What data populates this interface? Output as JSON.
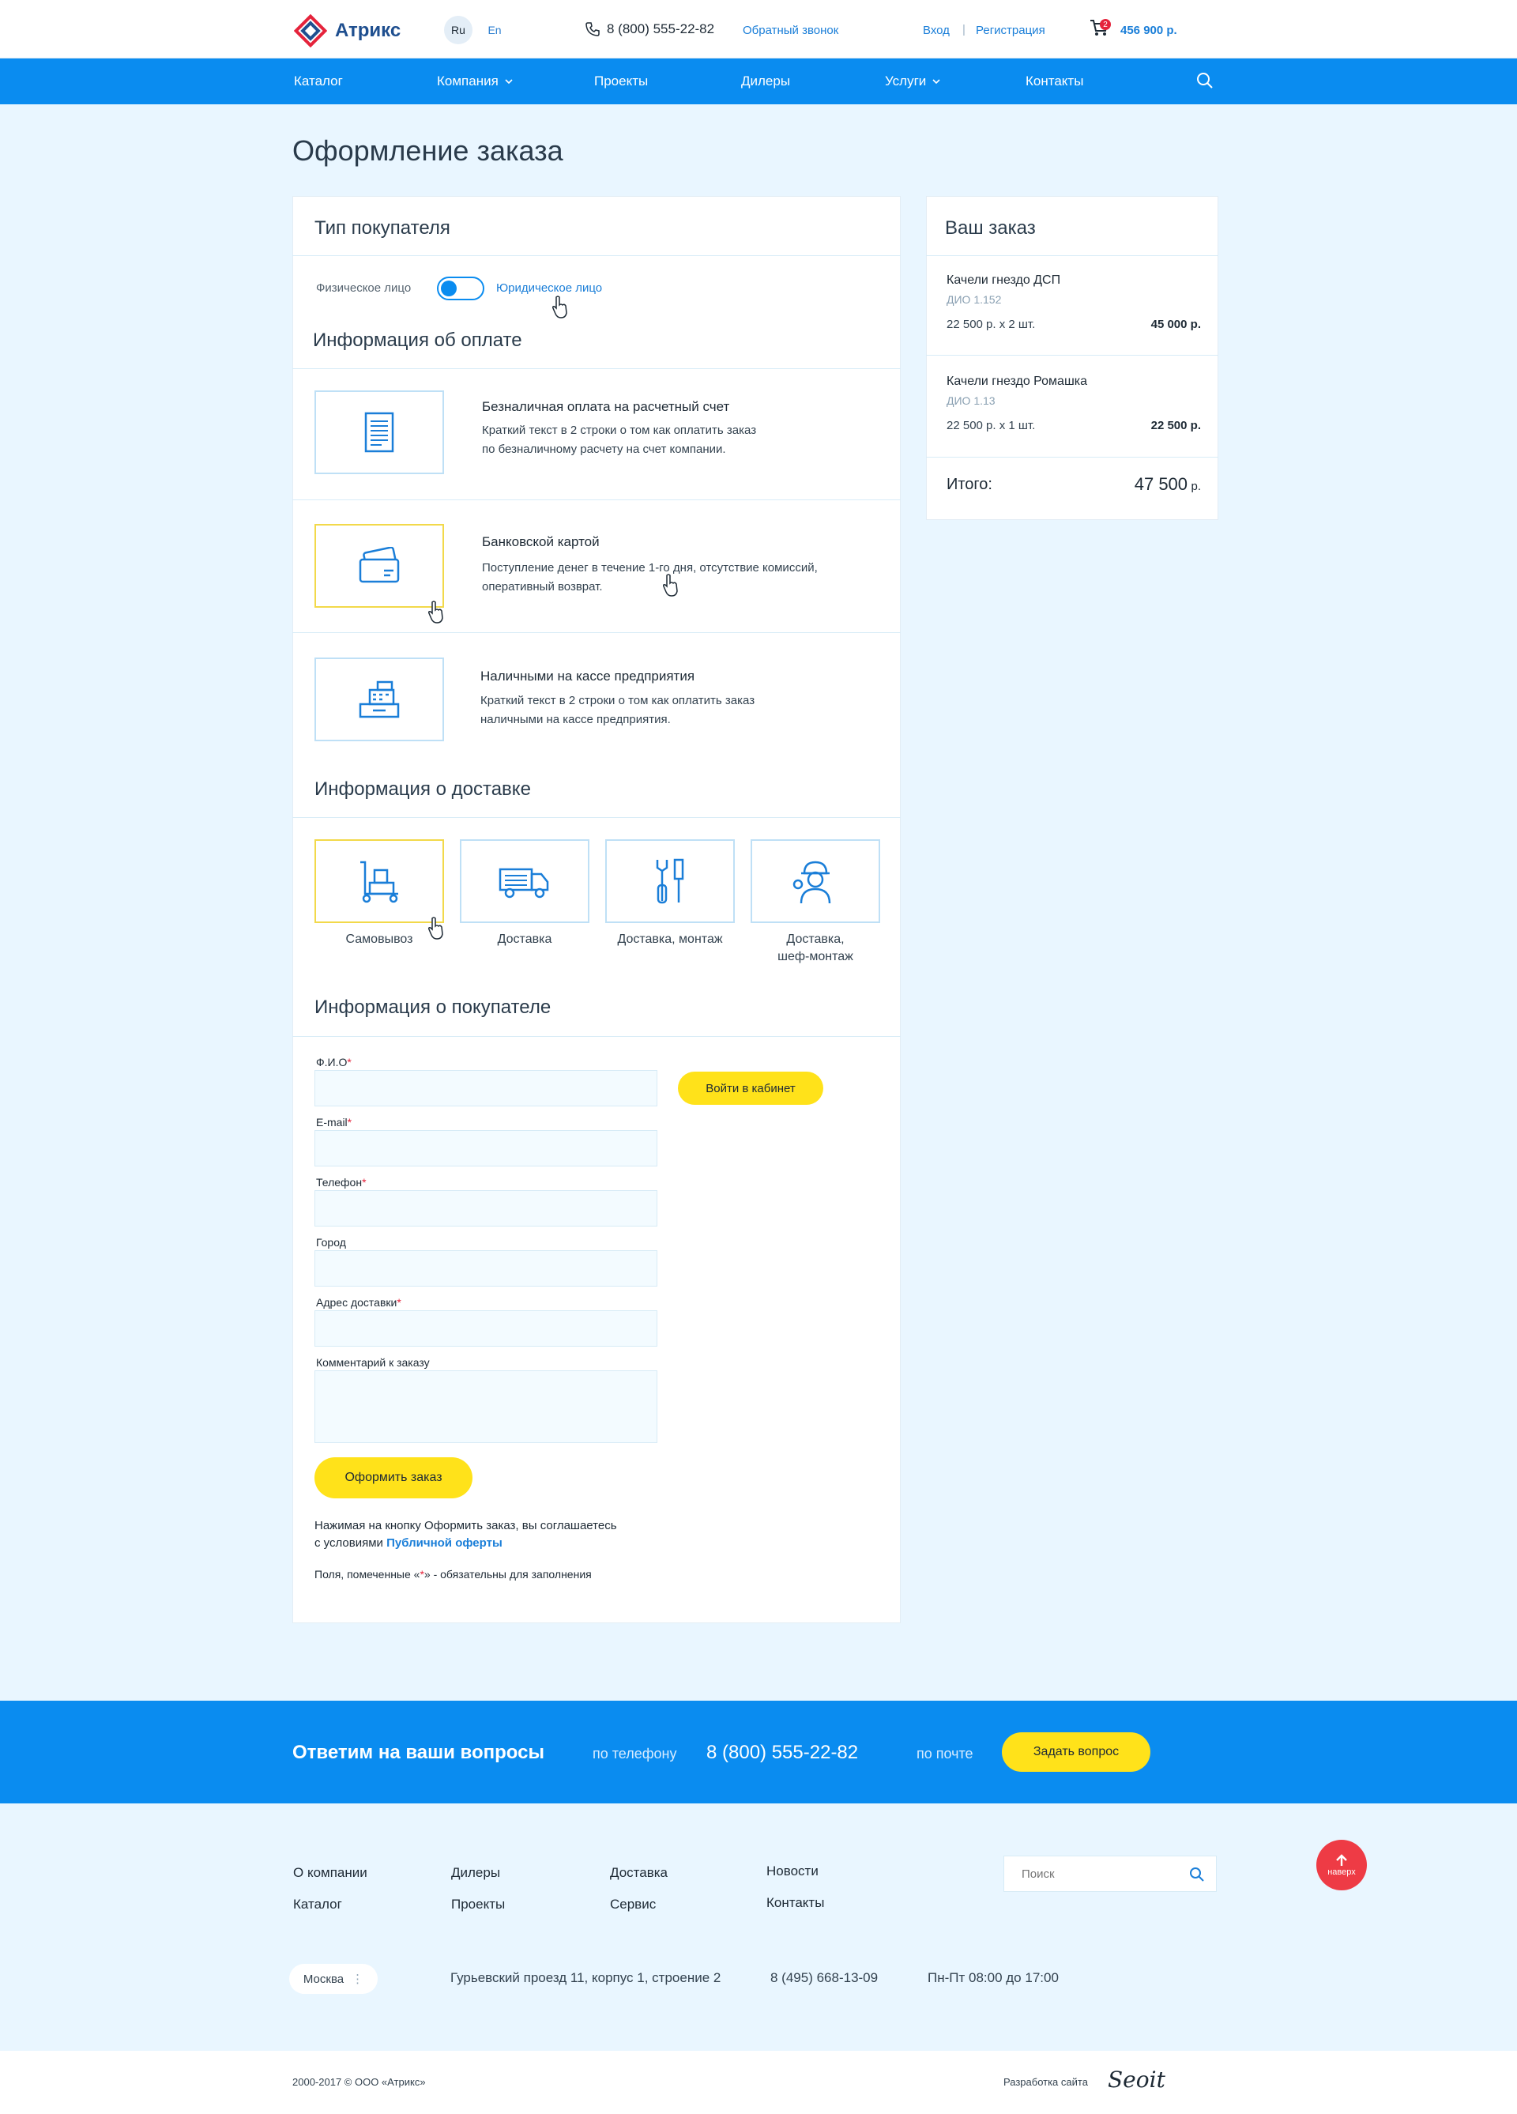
{
  "header": {
    "logo": "Атрикс",
    "langs": [
      "Ru",
      "En"
    ],
    "phone": "8 (800) 555-22-82",
    "callback": "Обратный звонок",
    "login": "Вход",
    "separator": "|",
    "register": "Регистрация",
    "cart_count": "2",
    "cart_total": "456 900 р."
  },
  "nav": {
    "items": [
      "Каталог",
      "Компания",
      "Проекты",
      "Дилеры",
      "Услуги",
      "Контакты"
    ]
  },
  "page": {
    "title": "Оформление заказа"
  },
  "buyer_type": {
    "title": "Тип покупателя",
    "individual": "Физическое лицо",
    "legal": "Юридическое лицо"
  },
  "payment": {
    "title": "Информация об оплате",
    "options": [
      {
        "title": "Безналичная оплата на расчетный счет",
        "desc1": "Краткий текст в 2 строки о том как оплатить заказ",
        "desc2": "по безналичному расчету на счет компании."
      },
      {
        "title": "Банковской картой",
        "desc1": "Поступление денег в течение 1-го дня, отсутствие комиссий,",
        "desc2": "оперативный возврат."
      },
      {
        "title": "Наличными на кассе предприятия",
        "desc1": "Краткий текст в 2 строки о том как оплатить заказ",
        "desc2": "наличными на кассе предприятия."
      }
    ]
  },
  "delivery": {
    "title": "Информация о доставке",
    "options": [
      "Самовывоз",
      "Доставка",
      "Доставка, монтаж",
      "Доставка,",
      "шеф-монтаж"
    ]
  },
  "customer": {
    "title": "Информация о покупателе",
    "fields": {
      "fio": "Ф.И.О",
      "email": "E-mail",
      "phone": "Телефон",
      "city": "Город",
      "address": "Адрес доставки",
      "comment": "Комментарий к заказу"
    },
    "required_mark": "*",
    "login_btn": "Войти в кабинет",
    "submit": "Оформить заказ",
    "agree1": "Нажимая на кнопку Оформить заказ, вы соглашаетесь",
    "agree2": "с условиями",
    "offer_link": "Публичной оферты",
    "note_pre": "Поля, помеченные «",
    "note_post": "» - обязательны для заполнения"
  },
  "order": {
    "title": "Ваш заказ",
    "items": [
      {
        "name": "Качели гнездо ДСП",
        "sku": "ДИО 1.152",
        "qty": "22 500 р. х 2 шт.",
        "sum": "45 000 р."
      },
      {
        "name": "Качели гнездо Ромашка",
        "sku": "ДИО 1.13",
        "qty": "22 500 р. х 1 шт.",
        "sum": "22 500 р."
      }
    ],
    "total_label": "Итого:",
    "total_value": "47 500",
    "total_unit": "р."
  },
  "band": {
    "title": "Ответим на ваши вопросы",
    "by_phone": "по телефону",
    "phone": "8 (800) 555-22-82",
    "by_mail": "по почте",
    "ask": "Задать вопрос"
  },
  "footer": {
    "links": [
      "О компании",
      "Каталог",
      "Дилеры",
      "Проекты",
      "Доставка",
      "Сервис",
      "Новости",
      "Контакты"
    ],
    "search_placeholder": "Поиск",
    "up": "наверх",
    "city": "Москва",
    "address": "Гурьевский проезд 11, корпус 1, строение 2",
    "phone": "8 (495) 668-13-09",
    "hours": "Пн-Пт 08:00 до 17:00",
    "copyright": "2000-2017 © ООО «Атрикс»",
    "dev": "Разработка сайта",
    "dev_logo": "Seoit"
  },
  "colors": {
    "accent": "#0a8cf0",
    "yellow": "#ffe21a",
    "red": "#e5233b",
    "bg": "#e9f6ff"
  }
}
